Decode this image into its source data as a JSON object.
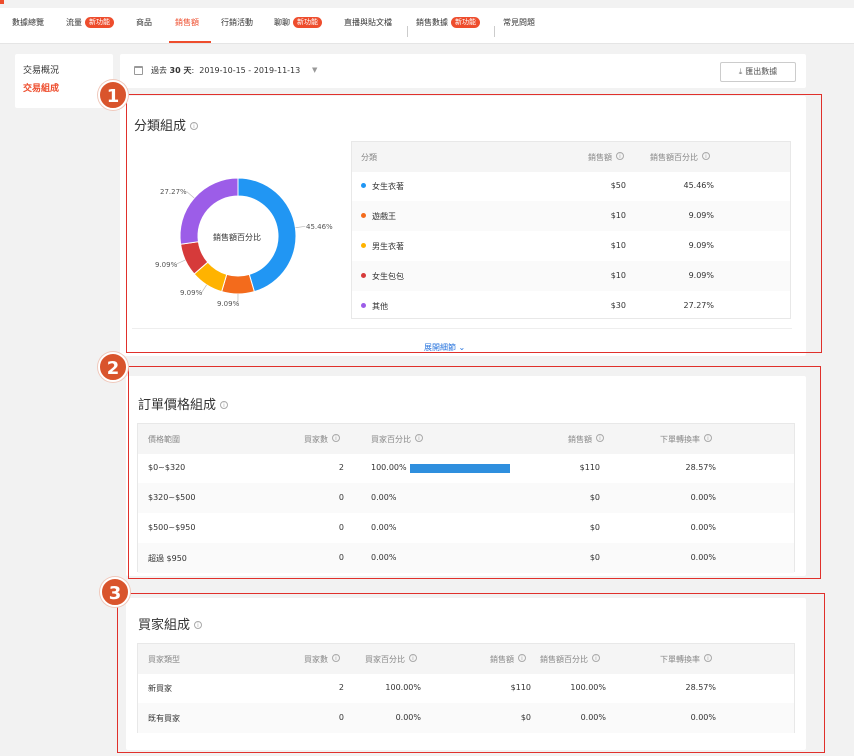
{
  "nav": {
    "items": [
      {
        "label": "數據總覽",
        "badge": ""
      },
      {
        "label": "流量",
        "badge": "新功能"
      },
      {
        "label": "商品",
        "badge": ""
      },
      {
        "label": "銷售額",
        "badge": ""
      },
      {
        "label": "行銷活動",
        "badge": ""
      },
      {
        "label": "聊聊",
        "badge": "新功能"
      },
      {
        "label": "直播與貼文檔",
        "badge": ""
      },
      {
        "label": "銷售數據",
        "badge": "新功能"
      },
      {
        "label": "常見問題",
        "badge": ""
      }
    ]
  },
  "sidebar": {
    "items": [
      {
        "label": "交易概況"
      },
      {
        "label": "交易組成"
      }
    ]
  },
  "filter": {
    "period_prefix": "過去",
    "period_days": "30 天",
    "period_colon": ":",
    "date_range": "2019-10-15 - 2019-11-13",
    "export_label": "匯出數據"
  },
  "markers": [
    "1",
    "2",
    "3"
  ],
  "category": {
    "title": "分類組成",
    "center_label": "銷售額百分比",
    "expand_label": "展開細節",
    "columns": [
      "分類",
      "銷售額",
      "銷售額百分比"
    ],
    "rows": [
      {
        "name": "女生衣著",
        "sales": "$50",
        "pct": "45.46%",
        "color": "#2196f3"
      },
      {
        "name": "遊戲王",
        "sales": "$10",
        "pct": "9.09%",
        "color": "#f36b1c"
      },
      {
        "name": "男生衣著",
        "sales": "$10",
        "pct": "9.09%",
        "color": "#ffb300"
      },
      {
        "name": "女生包包",
        "sales": "$10",
        "pct": "9.09%",
        "color": "#d63a3a"
      },
      {
        "name": "其他",
        "sales": "$30",
        "pct": "27.27%",
        "color": "#9c5de8"
      }
    ]
  },
  "price": {
    "title": "訂單價格組成",
    "columns": [
      "價格範圍",
      "買家數",
      "買家百分比",
      "銷售額",
      "下單轉換率"
    ],
    "rows": [
      {
        "range": "$0~$320",
        "buyers": "2",
        "buyer_pct": "100.00%",
        "buyer_share": 1.0,
        "sales": "$110",
        "conv": "28.57%"
      },
      {
        "range": "$320~$500",
        "buyers": "0",
        "buyer_pct": "0.00%",
        "buyer_share": 0,
        "sales": "$0",
        "conv": "0.00%"
      },
      {
        "range": "$500~$950",
        "buyers": "0",
        "buyer_pct": "0.00%",
        "buyer_share": 0,
        "sales": "$0",
        "conv": "0.00%"
      },
      {
        "range": "超過 $950",
        "buyers": "0",
        "buyer_pct": "0.00%",
        "buyer_share": 0,
        "sales": "$0",
        "conv": "0.00%"
      }
    ]
  },
  "buyer": {
    "title": "買家組成",
    "columns": [
      "買家類型",
      "買家數",
      "買家百分比",
      "銷售額",
      "銷售額百分比",
      "下單轉換率"
    ],
    "rows": [
      {
        "type": "新買家",
        "buyers": "2",
        "buyer_pct": "100.00%",
        "sales": "$110",
        "sales_pct": "100.00%",
        "conv": "28.57%"
      },
      {
        "type": "既有買家",
        "buyers": "0",
        "buyer_pct": "0.00%",
        "sales": "$0",
        "sales_pct": "0.00%",
        "conv": "0.00%"
      }
    ]
  },
  "chart_data": {
    "type": "pie",
    "categories": [
      "女生衣著",
      "遊戲王",
      "男生衣著",
      "女生包包",
      "其他"
    ],
    "values": [
      45.46,
      9.09,
      9.09,
      9.09,
      27.27
    ],
    "labels": [
      "45.46%",
      "9.09%",
      "9.09%",
      "9.09%",
      "27.27%"
    ],
    "colors": [
      "#2196f3",
      "#f36b1c",
      "#ffb300",
      "#d63a3a",
      "#9c5de8"
    ],
    "title": "銷售額百分比"
  }
}
